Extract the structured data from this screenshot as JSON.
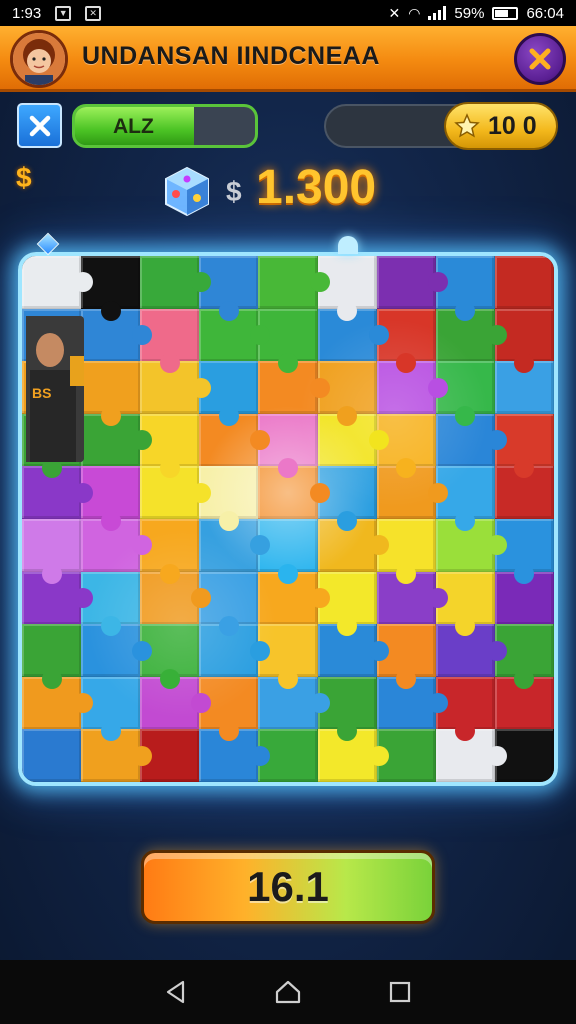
{
  "status_bar": {
    "time_left": "1:93",
    "battery_percent": "59%",
    "clock": "66:04"
  },
  "header": {
    "title": "UNDANSAN IINDCNEAA",
    "close_icon": "close-x-icon"
  },
  "top_row": {
    "x_button_icon": "x-icon",
    "progress": {
      "label": "ALZ",
      "fill_fraction": 0.66
    },
    "coins": {
      "value": "10 0",
      "icon": "star-icon"
    }
  },
  "money": {
    "side_symbol": "$",
    "currency_symbol": "$",
    "value": "1.300",
    "icon": "dice-icon"
  },
  "board": {
    "rows": 10,
    "cols": 9,
    "colors": [
      [
        "#e9ecef",
        "#111111",
        "#38a93a",
        "#2f86d6",
        "#48b837",
        "#e8eaee",
        "#7c2fb0",
        "#2a8ad8",
        "#c42a22"
      ],
      [
        "#2f86d6",
        "#2f86d6",
        "#ef6a8a",
        "#3fb63a",
        "#3fb63a",
        "#2a8ad8",
        "#d83628",
        "#3aa436",
        "#c42a22"
      ],
      [
        "#f0a01e",
        "#f0a01e",
        "#f3c42a",
        "#2a9ee0",
        "#f38a22",
        "#f0a01e",
        "#b84fe2",
        "#36b84a",
        "#3aa0e4"
      ],
      [
        "#3aa436",
        "#3aa436",
        "#f7d628",
        "#f38a22",
        "#eb78c8",
        "#f2e41e",
        "#f7b21e",
        "#2a86d8",
        "#d83a2a"
      ],
      [
        "#8a38c8",
        "#c84ad6",
        "#f5e22a",
        "#f7f0a8",
        "#f38a22",
        "#2a9ee0",
        "#f09a1e",
        "#36a8e8",
        "#c82a26"
      ],
      [
        "#cf7ae8",
        "#d064e0",
        "#f7a81e",
        "#36a0e0",
        "#2ab4ee",
        "#f0b81e",
        "#f6e22a",
        "#9adf3a",
        "#2a92de"
      ],
      [
        "#8a38c8",
        "#3cb6e6",
        "#f09a1e",
        "#3aa0e4",
        "#f7a81e",
        "#f3e82a",
        "#8a3ec8",
        "#f4d42a",
        "#7a2ab8"
      ],
      [
        "#3aa436",
        "#2a92de",
        "#38b038",
        "#2a9ee0",
        "#f7c42a",
        "#2a8ad8",
        "#f38a22",
        "#6a3ec8",
        "#3aa436"
      ],
      [
        "#f09a1e",
        "#36a8e8",
        "#c24ad2",
        "#f38a22",
        "#3aa0e4",
        "#3aa436",
        "#2a86d8",
        "#c8262a",
        "#c8262a"
      ],
      [
        "#2a7ad0",
        "#f0a01e",
        "#b81c1c",
        "#2a86d8",
        "#38a93a",
        "#f3e82a",
        "#3aa436",
        "#e8eaee",
        "#111111"
      ]
    ]
  },
  "score_button": {
    "label": "16.1"
  },
  "nav": {
    "back_icon": "back-triangle-icon",
    "home_icon": "home-icon",
    "recents_icon": "recents-square-icon"
  }
}
